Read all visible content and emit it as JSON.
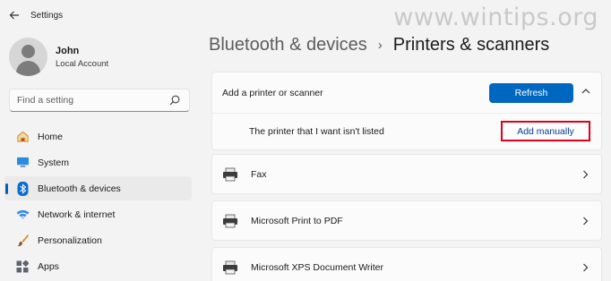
{
  "app": {
    "title": "Settings",
    "watermark": "www.wintips.org"
  },
  "profile": {
    "name": "John",
    "account_type": "Local Account"
  },
  "search": {
    "placeholder": "Find a setting"
  },
  "sidebar": {
    "items": [
      {
        "label": "Home",
        "icon": "home-icon",
        "active": false
      },
      {
        "label": "System",
        "icon": "monitor-icon",
        "active": false
      },
      {
        "label": "Bluetooth & devices",
        "icon": "bluetooth-icon",
        "active": true
      },
      {
        "label": "Network & internet",
        "icon": "wifi-icon",
        "active": false
      },
      {
        "label": "Personalization",
        "icon": "brush-icon",
        "active": false
      },
      {
        "label": "Apps",
        "icon": "apps-icon",
        "active": false
      }
    ]
  },
  "breadcrumb": {
    "parent": "Bluetooth & devices",
    "separator": "›",
    "current": "Printers & scanners"
  },
  "add_printer": {
    "label": "Add a printer or scanner",
    "refresh_label": "Refresh",
    "not_listed_label": "The printer that I want isn't listed",
    "add_manually_label": "Add manually"
  },
  "printers": [
    {
      "name": "Fax",
      "icon": "printer-icon"
    },
    {
      "name": "Microsoft Print to PDF",
      "icon": "printer-icon"
    },
    {
      "name": "Microsoft XPS Document Writer",
      "icon": "printer-icon"
    }
  ],
  "colors": {
    "accent": "#0067c0",
    "highlight": "#e0001a",
    "link": "#003e92"
  }
}
